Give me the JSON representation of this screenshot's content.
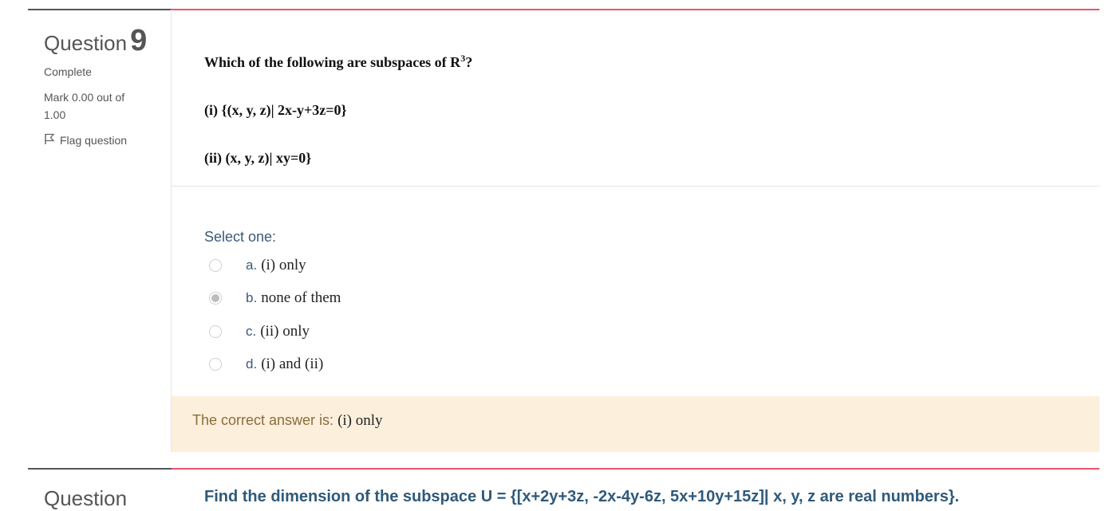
{
  "question9": {
    "title_word": "Question",
    "number": "9",
    "state": "Complete",
    "mark_line1": "Mark 0.00 out of",
    "mark_line2": "1.00",
    "flag_label": "Flag question",
    "prompt": "Which of the following are subspaces of R",
    "prompt_sup": "3",
    "prompt_end": "?",
    "statement_i": "(i) {(x, y, z)| 2x-y+3z=0}",
    "statement_ii": "(ii) (x, y, z)| xy=0}",
    "select_label": "Select one:",
    "options": [
      {
        "letter": "a.",
        "text": "(i) only",
        "selected": false
      },
      {
        "letter": "b.",
        "text": "none of them",
        "selected": true
      },
      {
        "letter": "c.",
        "text": "(ii) only",
        "selected": false
      },
      {
        "letter": "d.",
        "text": "(i) and (ii)",
        "selected": false
      }
    ],
    "feedback_label": "The correct answer is: ",
    "feedback_answer": "(i) only"
  },
  "question10": {
    "title_word": "Question",
    "prompt": "Find the dimension of the subspace U = {[x+2y+3z, -2x-4y-6z, 5x+10y+15z]| x, y, z are real numbers}."
  },
  "colors": {
    "accent_rule": "#e8576d",
    "feedback_bg": "#fcefdc",
    "link_blue": "#3a5a78"
  }
}
